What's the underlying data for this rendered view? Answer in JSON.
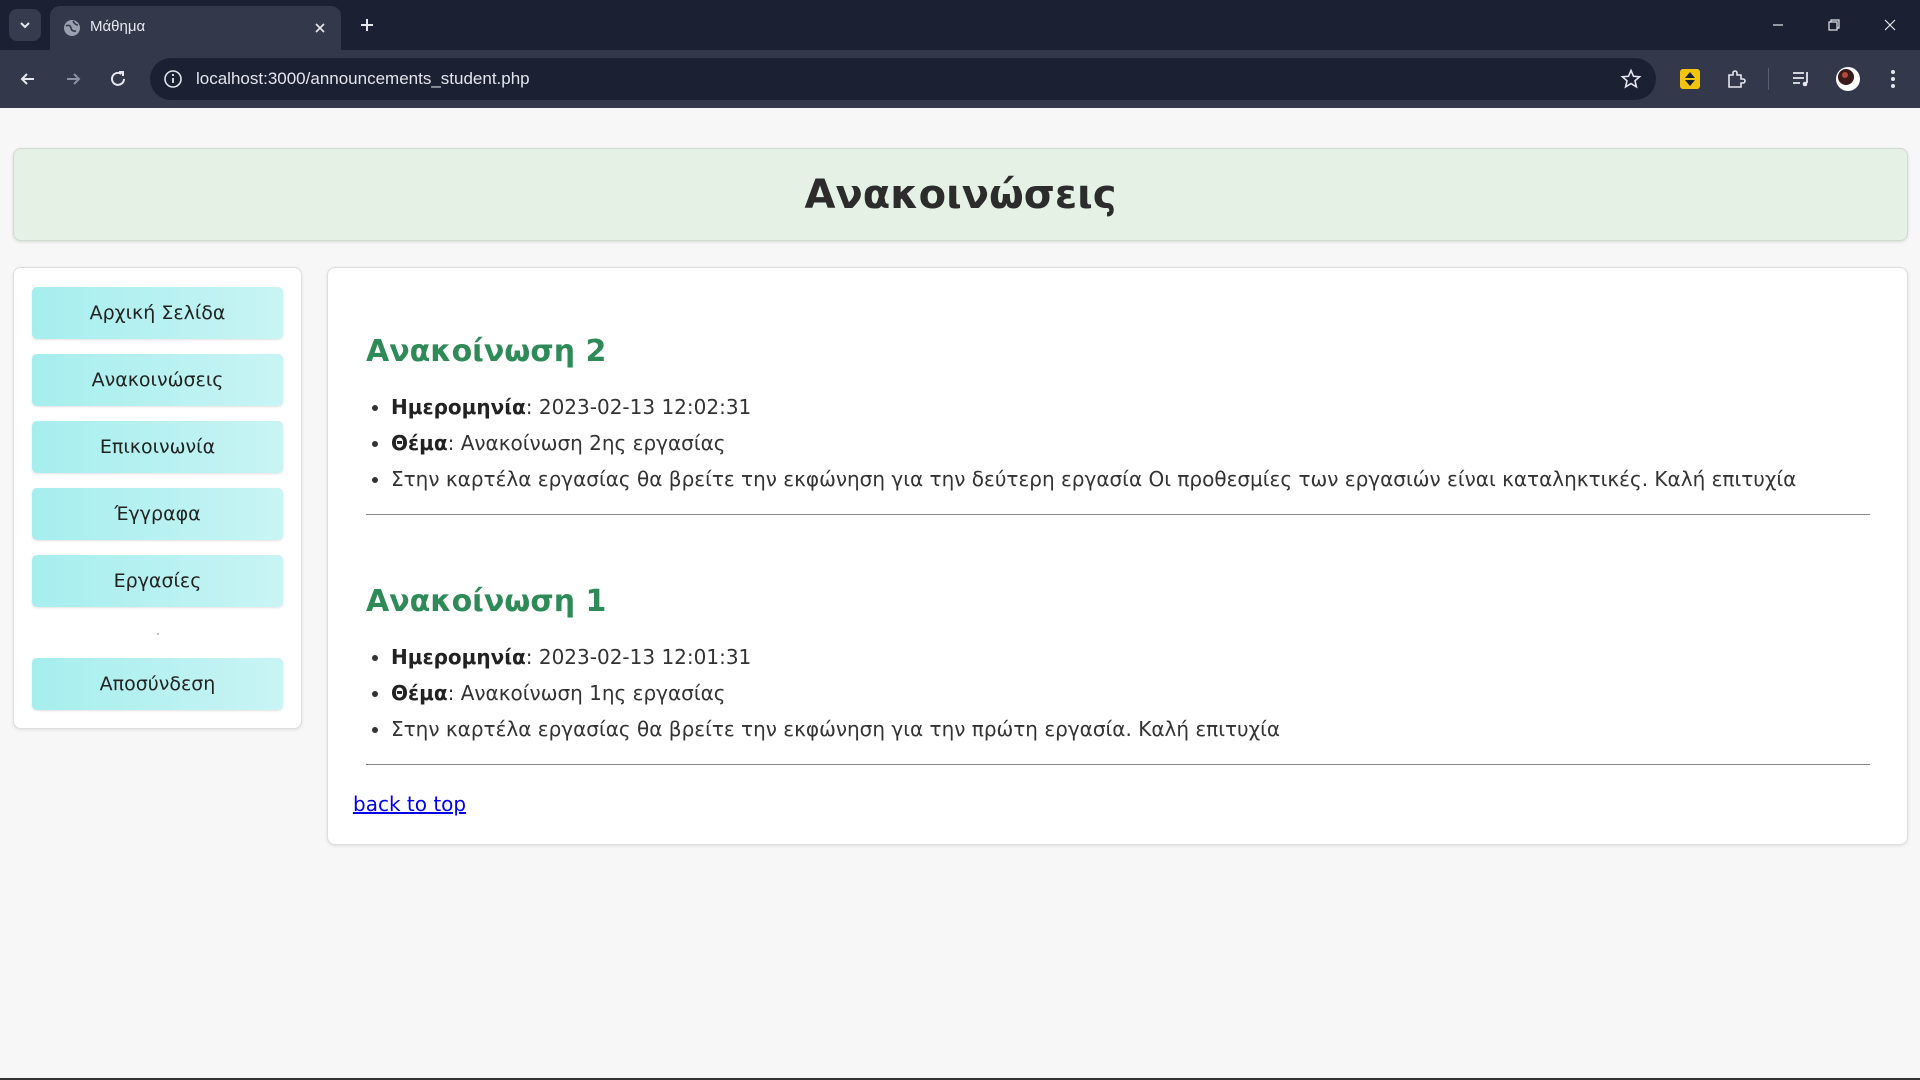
{
  "browser": {
    "tab_title": "Μάθημα",
    "url": "localhost:3000/announcements_student.php"
  },
  "page": {
    "title": "Ανακοινώσεις",
    "sidebar": {
      "items": [
        {
          "label": "Αρχική Σελίδα"
        },
        {
          "label": "Ανακοινώσεις"
        },
        {
          "label": "Επικοινωνία"
        },
        {
          "label": "Έγγραφα"
        },
        {
          "label": "Εργασίες"
        }
      ],
      "logout_label": "Αποσύνδεση"
    },
    "announcements": [
      {
        "title": "Ανακοίνωση 2",
        "date_label": "Ημερομηνία",
        "date": ": 2023-02-13 12:02:31",
        "subject_label": "Θέμα",
        "subject": ": Ανακοίνωση 2ης εργασίας",
        "body": "Στην καρτέλα εργασίας θα βρείτε την εκφώνηση για την δεύτερη εργασία Οι προθεσμίες των εργασιών είναι καταληκτικές. Καλή επιτυχία"
      },
      {
        "title": "Ανακοίνωση 1",
        "date_label": "Ημερομηνία",
        "date": ": 2023-02-13 12:01:31",
        "subject_label": "Θέμα",
        "subject": ": Ανακοίνωση 1ης εργασίας",
        "body": "Στην καρτέλα εργασίας θα βρείτε την εκφώνηση για την πρώτη εργασία. Καλή επιτυχία"
      }
    ],
    "back_to_top": "back to top"
  },
  "colors": {
    "chrome_dark": "#1c2033",
    "chrome_toolbar": "#33384a",
    "header_bg": "#e5f1e5",
    "nav_button": "#a6eeee",
    "announcement_title": "#2e8a57",
    "link": "#0000ee"
  }
}
